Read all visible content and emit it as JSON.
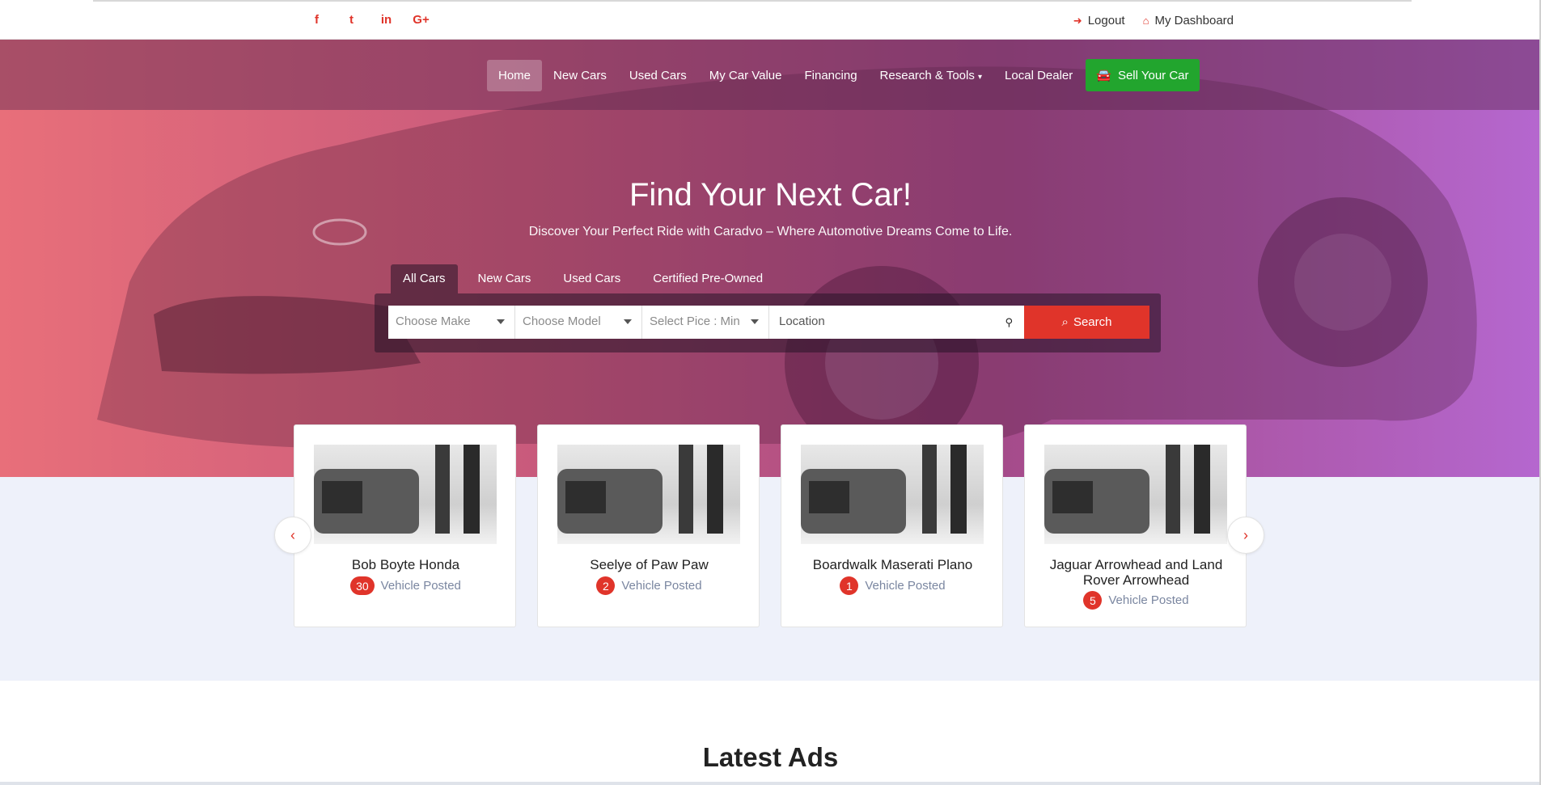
{
  "social": [
    "f",
    "t",
    "in",
    "G+"
  ],
  "top_links": {
    "logout": "Logout",
    "dashboard": "My Dashboard"
  },
  "nav": {
    "items": [
      "Home",
      "New Cars",
      "Used Cars",
      "My Car Value",
      "Financing",
      "Research & Tools",
      "Local Dealer"
    ],
    "sell": "Sell Your Car"
  },
  "hero": {
    "title": "Find Your Next Car!",
    "subtitle": "Discover Your Perfect Ride with Caradvo – Where Automotive Dreams Come to Life."
  },
  "tabs": [
    "All Cars",
    "New Cars",
    "Used Cars",
    "Certified Pre-Owned"
  ],
  "search": {
    "make_placeholder": "Choose Make",
    "model_placeholder": "Choose Model",
    "price_placeholder": "Select Pice : Min",
    "location_placeholder": "Location",
    "button": "Search"
  },
  "dealers": [
    {
      "name": "Bob Boyte Honda",
      "count": "30",
      "label": "Vehicle Posted"
    },
    {
      "name": "Seelye of Paw Paw",
      "count": "2",
      "label": "Vehicle Posted"
    },
    {
      "name": "Boardwalk Maserati Plano",
      "count": "1",
      "label": "Vehicle Posted"
    },
    {
      "name": "Jaguar Arrowhead and Land Rover Arrowhead",
      "count": "5",
      "label": "Vehicle Posted"
    }
  ],
  "carousel": {
    "prev": "‹",
    "next": "›"
  },
  "section_title": "Latest Ads",
  "colors": {
    "accent": "#e0342a",
    "sell": "#22a52e"
  }
}
